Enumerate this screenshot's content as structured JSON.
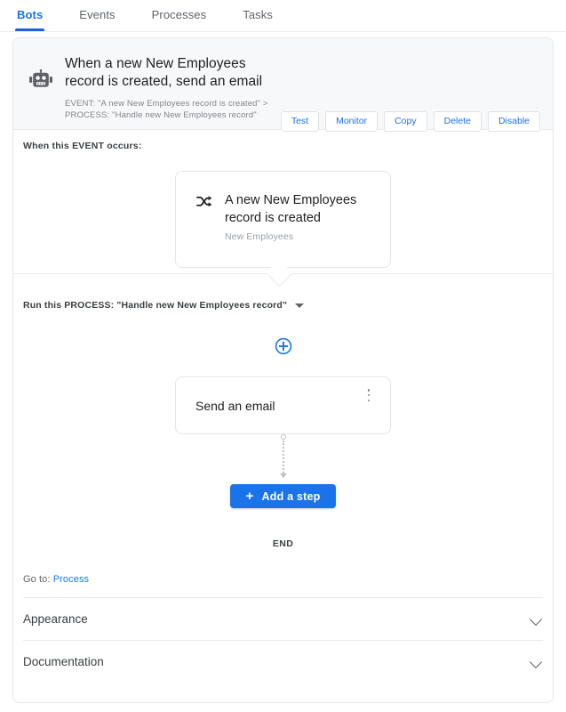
{
  "tabs": [
    {
      "label": "Bots",
      "active": true
    },
    {
      "label": "Events",
      "active": false
    },
    {
      "label": "Processes",
      "active": false
    },
    {
      "label": "Tasks",
      "active": false
    }
  ],
  "header": {
    "icon": "robot-icon",
    "title": "When a new New Employees record is created, send an email",
    "subtitle_line1": "EVENT: \"A new New Employees record is created\" >",
    "subtitle_line2": "PROCESS: \"Handle new New Employees record\"",
    "actions": [
      {
        "label": "Test"
      },
      {
        "label": "Monitor"
      },
      {
        "label": "Copy"
      },
      {
        "label": "Delete"
      },
      {
        "label": "Disable"
      }
    ]
  },
  "event_section": {
    "label": "When this EVENT occurs:",
    "card": {
      "icon": "shuffle-icon",
      "title": "A new New Employees record is created",
      "subtitle": "New Employees"
    }
  },
  "process_section": {
    "label": "Run this PROCESS: \"Handle new New Employees record\"",
    "add_node_icon": "plus-circle-icon",
    "step": {
      "label": "Send an email",
      "menu_icon": "kebab-menu-icon"
    },
    "add_step_button": {
      "label": "Add a step",
      "icon": "plus-icon"
    },
    "end_label": "END"
  },
  "footer": {
    "goto_prefix": "Go to:",
    "goto_link": "Process",
    "sections": [
      {
        "label": "Appearance",
        "icon": "chevron-down-icon"
      },
      {
        "label": "Documentation",
        "icon": "chevron-down-icon"
      }
    ]
  },
  "colors": {
    "accent_blue": "#1a73e8",
    "tab_underline": "#1a60e0",
    "header_bg": "#f7f8fa",
    "border": "#e4e6e8",
    "text_primary": "#202124",
    "text_secondary": "#5f6368",
    "text_muted": "#9aa0a6",
    "connector": "#bdc1c6"
  }
}
